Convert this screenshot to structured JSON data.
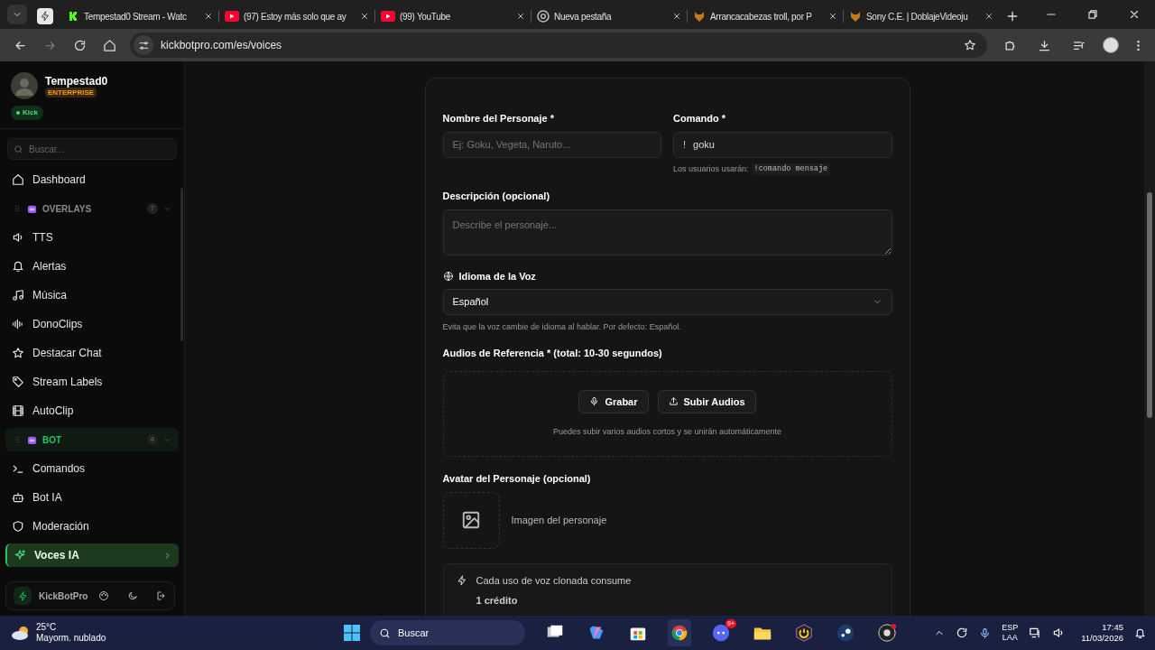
{
  "browser": {
    "tabs": [
      {
        "title": "Tempestad0 Stream - Watc",
        "selected": false
      },
      {
        "title": "(97) Estoy más solo que ay",
        "selected": false
      },
      {
        "title": "(99) YouTube",
        "selected": false
      },
      {
        "title": "Nueva pestaña",
        "selected": false
      },
      {
        "title": "Arrancacabezas troll, por P",
        "selected": false
      },
      {
        "title": "Sony C.E. | DoblajeVideoju",
        "selected": false
      }
    ],
    "url": "kickbotpro.com/es/voices"
  },
  "sidebar": {
    "user": {
      "name": "Tempestad0",
      "plan": "ENTERPRISE",
      "platform": "Kick"
    },
    "search": {
      "placeholder": "Buscar..."
    },
    "items": [
      {
        "kind": "link",
        "label": "Dashboard",
        "selected": false
      },
      {
        "kind": "group",
        "label": "OVERLAYS",
        "count": "7",
        "color": "#8b8b8b"
      },
      {
        "kind": "link",
        "label": "TTS",
        "selected": false
      },
      {
        "kind": "link",
        "label": "Alertas",
        "selected": false
      },
      {
        "kind": "link",
        "label": "Música",
        "selected": false
      },
      {
        "kind": "link",
        "label": "DonoClips",
        "selected": false
      },
      {
        "kind": "link",
        "label": "Destacar Chat",
        "selected": false
      },
      {
        "kind": "link",
        "label": "Stream Labels",
        "selected": false
      },
      {
        "kind": "link",
        "label": "AutoClip",
        "selected": false
      },
      {
        "kind": "group",
        "label": "BOT",
        "count": "4",
        "color": "#22c55e"
      },
      {
        "kind": "link",
        "label": "Comandos",
        "selected": false
      },
      {
        "kind": "link",
        "label": "Bot IA",
        "selected": false
      },
      {
        "kind": "link",
        "label": "Moderación",
        "selected": false
      },
      {
        "kind": "link",
        "label": "Voces IA",
        "selected": true
      }
    ],
    "footer": {
      "brand": "KickBotPro"
    }
  },
  "form": {
    "name_field": {
      "label": "Nombre del Personaje *",
      "placeholder": "Ej: Goku, Vegeta, Naruto..."
    },
    "command_field": {
      "label": "Comando *",
      "prefix": "!",
      "value": "goku",
      "hint": "Los usuarios usarán:",
      "hint_code": "!comando mensaje"
    },
    "description_field": {
      "label": "Descripción (opcional)",
      "placeholder": "Describe el personaje..."
    },
    "language_field": {
      "label": "Idioma de la Voz",
      "value": "Español",
      "hint": "Evita que la voz cambie de idioma al hablar. Por defecto: Español."
    },
    "audio": {
      "label": "Audios de Referencia * (total: 10-30 segundos)",
      "buttons": [
        "Grabar",
        "Subir Audios"
      ],
      "hint": "Puedes subir varios audios cortos y se unirán automáticamente"
    },
    "avatar": {
      "label": "Avatar del Personaje (opcional)",
      "caption": "Imagen del personaje"
    },
    "cost": {
      "text": "Cada uso de voz clonada consume",
      "amount": "1 crédito"
    }
  },
  "taskbar": {
    "weather": {
      "temp": "25°C",
      "condition": "Mayorm. nublado"
    },
    "search": {
      "placeholder": "Buscar"
    },
    "discord_badge": "9+",
    "lang": {
      "top": "ESP",
      "bottom": "LAA"
    },
    "time": "17:45",
    "date": "11/03/2026"
  }
}
